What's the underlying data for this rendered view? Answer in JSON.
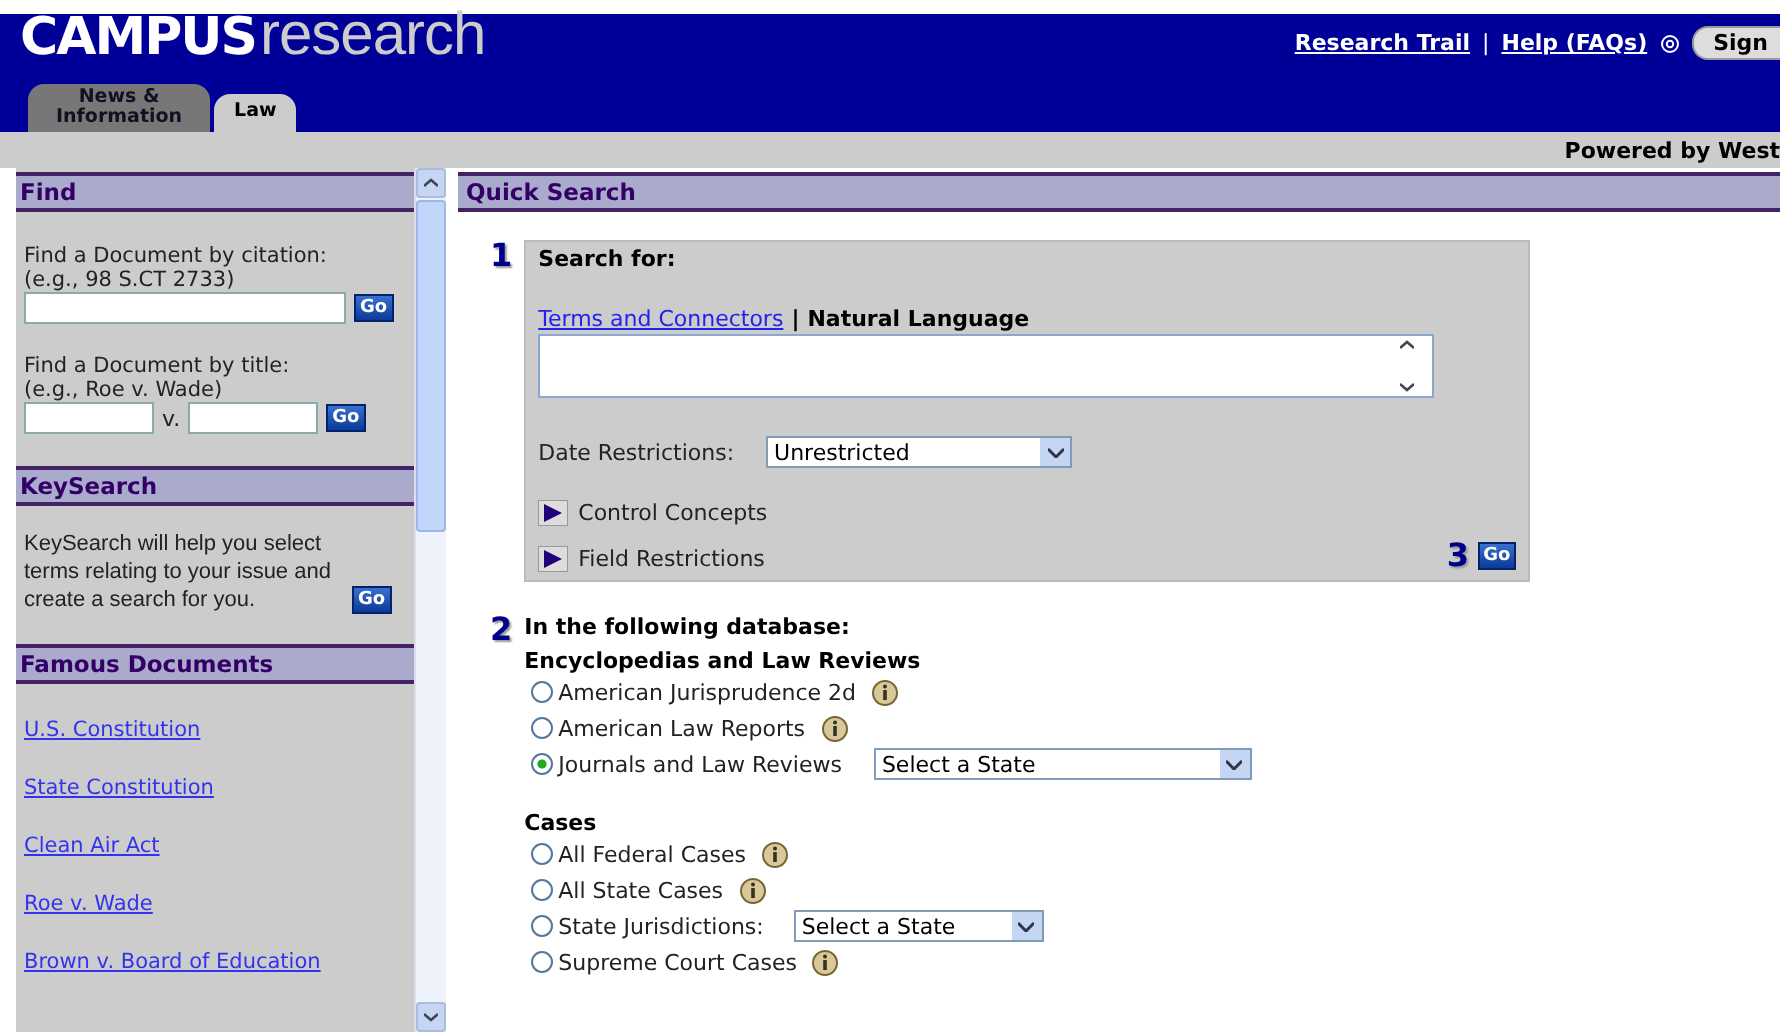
{
  "header": {
    "logo": {
      "brand": "CAMPUS",
      "product": "research"
    },
    "links": [
      {
        "label": "Research Trail"
      },
      {
        "label": "Help (FAQs)"
      }
    ],
    "separator": "|",
    "sign_in": "Sign",
    "tabs": [
      {
        "label": "News &\nInformation",
        "selected": false
      },
      {
        "label": "Law",
        "selected": true
      }
    ]
  },
  "powered_by": "Powered by West",
  "sidebar": {
    "find": {
      "title": "Find",
      "citation_label": "Find a Document by citation:\n(e.g., 98 S.CT 2733)",
      "citation_go": "Go",
      "title_label": "Find a Document by title:\n(e.g., Roe v. Wade)",
      "versus": "v.",
      "title_go": "Go"
    },
    "keysearch": {
      "title": "KeySearch",
      "text": "KeySearch will help you select terms relating to your issue and create a search for you.",
      "go": "Go"
    },
    "famous": {
      "title": "Famous Documents",
      "links": [
        "U.S. Constitution",
        "State Constitution",
        "Clean Air Act",
        "Roe v. Wade",
        "Brown v. Board of Education"
      ]
    }
  },
  "main": {
    "title": "Quick Search",
    "step1": {
      "number": "1",
      "label": "Search for:",
      "modes": [
        {
          "label": "Terms and Connectors",
          "selected": false
        },
        {
          "label": "Natural Language",
          "selected": true
        }
      ],
      "separator": "|",
      "date_label": "Date Restrictions:",
      "date_value": "Unrestricted",
      "expanders": [
        {
          "label": "Control Concepts",
          "expanded": false
        },
        {
          "label": "Field Restrictions",
          "expanded": false
        }
      ],
      "go_number": "3",
      "go": "Go"
    },
    "step2": {
      "number": "2",
      "label": "In the following database:",
      "groups": [
        {
          "title": "Encyclopedias and Law Reviews",
          "options": [
            {
              "label": "American Jurisprudence 2d",
              "selected": false,
              "info": true
            },
            {
              "label": "American Law Reports",
              "selected": false,
              "info": true
            },
            {
              "label": "Journals and Law Reviews",
              "selected": true,
              "info": false,
              "select": "Select a State",
              "kind": "wide"
            }
          ]
        },
        {
          "title": "Cases",
          "options": [
            {
              "label": "All Federal Cases",
              "selected": false,
              "info": true
            },
            {
              "label": "All State Cases",
              "selected": false,
              "info": true
            },
            {
              "label": "State Jurisdictions:",
              "selected": false,
              "info": false,
              "select": "Select a State",
              "kind": "narrow"
            },
            {
              "label": "Supreme Court Cases",
              "selected": false,
              "info": true
            }
          ]
        }
      ]
    }
  }
}
